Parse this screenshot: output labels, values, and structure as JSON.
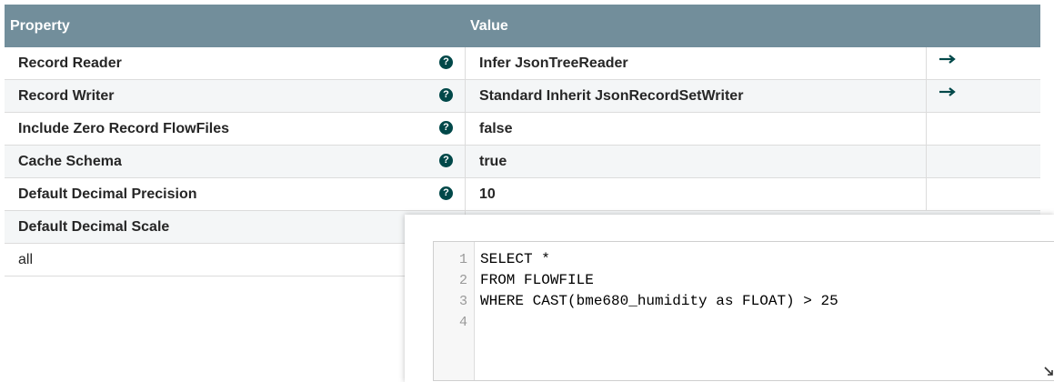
{
  "table": {
    "headers": {
      "property": "Property",
      "value": "Value"
    },
    "rows": [
      {
        "property": "Record Reader",
        "value": "Infer JsonTreeReader",
        "help": true,
        "link": true
      },
      {
        "property": "Record Writer",
        "value": "Standard Inherit JsonRecordSetWriter",
        "help": true,
        "link": true
      },
      {
        "property": "Include Zero Record FlowFiles",
        "value": "false",
        "help": true,
        "link": false
      },
      {
        "property": "Cache Schema",
        "value": "true",
        "help": true,
        "link": false
      },
      {
        "property": "Default Decimal Precision",
        "value": "10",
        "help": true,
        "link": false
      },
      {
        "property": "Default Decimal Scale",
        "value": "",
        "help": false,
        "link": false
      },
      {
        "property": "all",
        "value": "",
        "help": false,
        "link": false
      }
    ]
  },
  "editor": {
    "line_numbers": [
      "1",
      "2",
      "3",
      "4"
    ],
    "lines": [
      "SELECT *",
      "FROM FLOWFILE",
      "WHERE CAST(bme680_humidity as FLOAT) > 25",
      ""
    ]
  },
  "icons": {
    "help": "question-circle-icon",
    "link": "arrow-right-icon",
    "resize": "resize-handle-icon"
  },
  "colors": {
    "header_bg": "#728e9b",
    "help_icon": "#004849",
    "arrow": "#004849"
  }
}
